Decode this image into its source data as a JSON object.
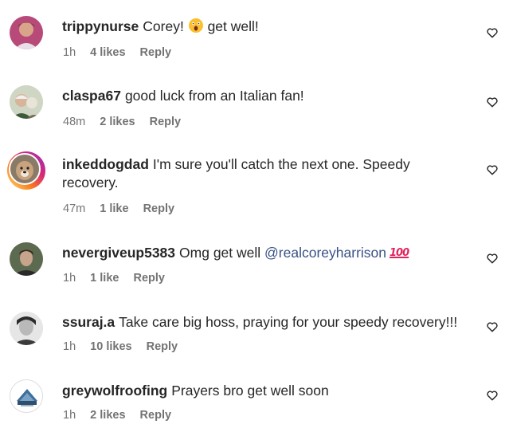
{
  "comments": [
    {
      "username": "trippynurse",
      "text_before": "Corey!",
      "emoji": "astonished-face",
      "text_after": "get well!",
      "time": "1h",
      "likes": "4 likes",
      "reply": "Reply"
    },
    {
      "username": "claspa67",
      "text": "good luck from an Italian fan!",
      "time": "48m",
      "likes": "2 likes",
      "reply": "Reply"
    },
    {
      "username": "inkeddogdad",
      "text": "I'm sure you'll catch the next one. Speedy recovery.",
      "time": "47m",
      "likes": "1 like",
      "reply": "Reply"
    },
    {
      "username": "nevergiveup5383",
      "text": "Omg get well",
      "mention": "@realcoreyharrison",
      "emoji_text": "100",
      "time": "1h",
      "likes": "1 like",
      "reply": "Reply"
    },
    {
      "username": "ssuraj.a",
      "text": "Take care big hoss, praying for your speedy recovery!!!",
      "time": "1h",
      "likes": "10 likes",
      "reply": "Reply"
    },
    {
      "username": "greywolfroofing",
      "text": "Prayers bro get well soon",
      "time": "1h",
      "likes": "2 likes",
      "reply": "Reply"
    }
  ],
  "colors": {
    "text": "#262626",
    "secondary": "#737373",
    "mention": "#385185"
  },
  "icons": {
    "like": "heart-outline-icon"
  }
}
